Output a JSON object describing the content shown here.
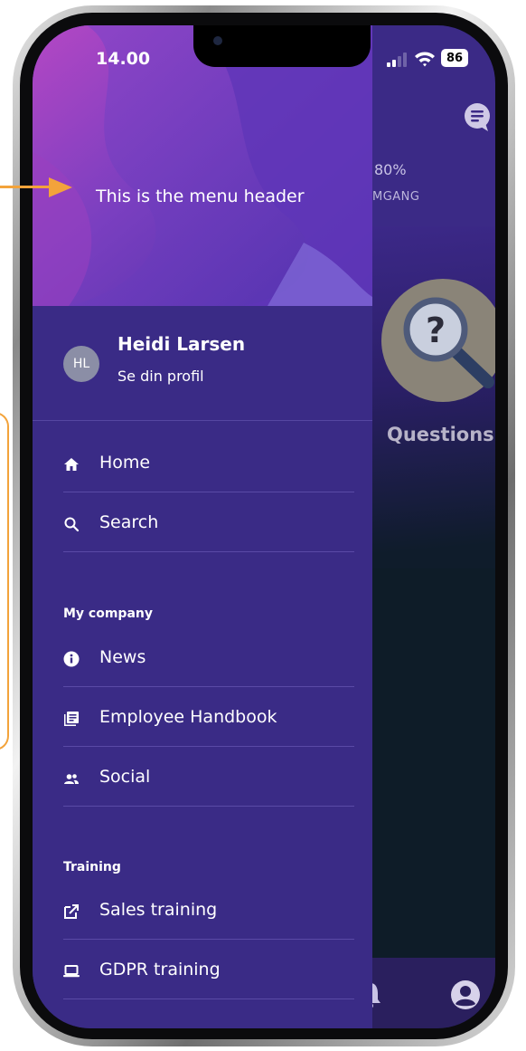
{
  "status_bar": {
    "time": "14.00",
    "battery": "86"
  },
  "drawer": {
    "header_title": "This is the menu header",
    "profile": {
      "initials": "HL",
      "name": "Heidi Larsen",
      "subtitle": "Se din profil"
    },
    "items_top": [
      {
        "label": "Home",
        "icon": "home-icon"
      },
      {
        "label": "Search",
        "icon": "search-icon"
      }
    ],
    "section_company": {
      "title": "My company",
      "items": [
        {
          "label": "News",
          "icon": "info-icon"
        },
        {
          "label": "Employee Handbook",
          "icon": "book-icon"
        },
        {
          "label": "Social",
          "icon": "people-icon"
        }
      ]
    },
    "section_training": {
      "title": "Training",
      "items": [
        {
          "label": "Sales training",
          "icon": "external-link-icon"
        },
        {
          "label": "GDPR training",
          "icon": "laptop-icon"
        }
      ]
    }
  },
  "background": {
    "progress_percent": "80%",
    "progress_label": "MGANG",
    "card_label": "Questions"
  },
  "colors": {
    "drawer": "#3a2b86",
    "accent": "#f3a33b",
    "text": "#ffffff"
  }
}
